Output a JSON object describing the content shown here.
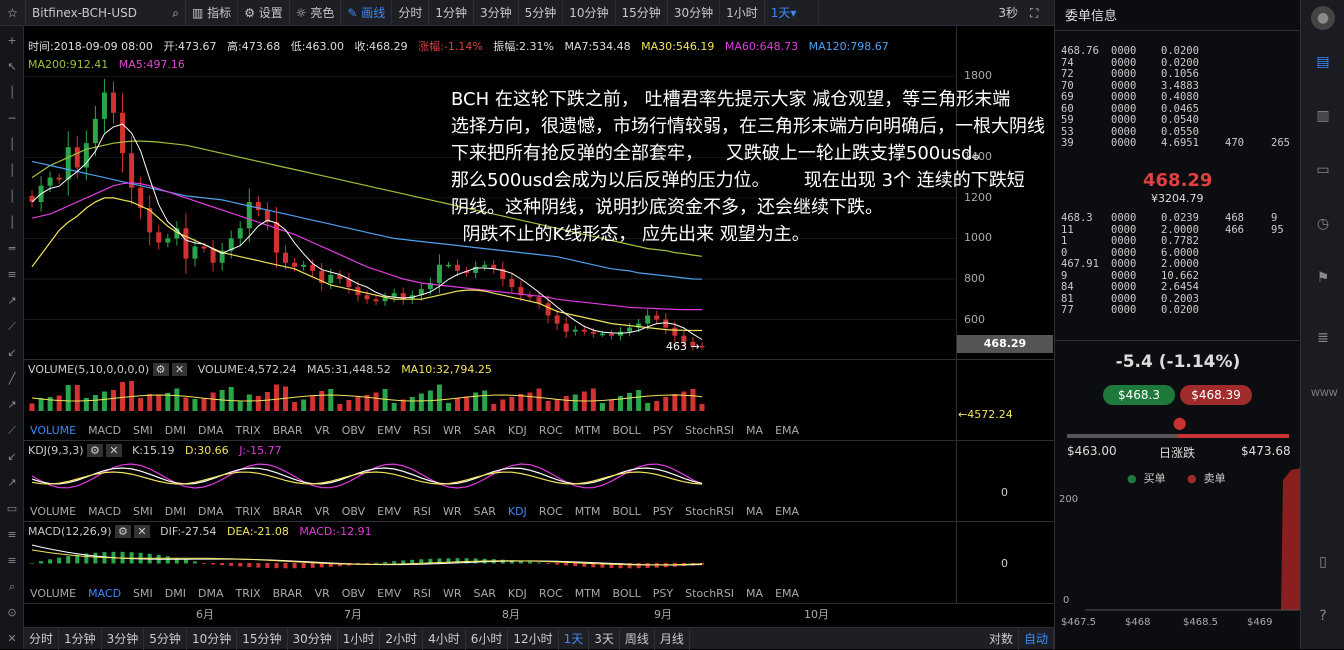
{
  "toolbar": {
    "symbol": "Bitfinex-BCH-USD",
    "indicators": "指标",
    "settings": "设置",
    "theme": "亮色",
    "draw": "画线",
    "intervals": [
      "分时",
      "1分钟",
      "3分钟",
      "5分钟",
      "10分钟",
      "15分钟",
      "30分钟",
      "1小时"
    ],
    "interval_selected": "1天▾",
    "refresh": "3秒",
    "fullscreen_icon": "expand-icon"
  },
  "info": {
    "time": "时间:2018-09-09 08:00",
    "open": "开:473.67",
    "high": "高:473.68",
    "low": "低:463.00",
    "close": "收:468.29",
    "chg": "涨幅:-1.14%",
    "amp": "振幅:2.31%",
    "ma7": "MA7:534.48",
    "ma30": "MA30:546.19",
    "ma60": "MA60:648.73",
    "ma120": "MA120:798.67",
    "ma200": "MA200:912.41",
    "ma5": "MA5:497.16"
  },
  "colors": {
    "ma30": "#f2e35a",
    "ma60": "#e03ae0",
    "ma120": "#4ea1f0",
    "ma200": "#9ec23a",
    "ma5": "#ffffff",
    "up": "#2aa64a",
    "down": "#d23232",
    "accent": "#3d8af7"
  },
  "annotation": [
    "BCH 在这轮下跌之前， 吐槽君率先提示大家 减仓观望，等三角形末端",
    "选择方向，很遗憾，市场行情较弱，在三角形末端方向明确后，一根大阴线",
    "下来把所有抢反弹的全部套牢，    又跌破上一轮止跌支撑500usd。",
    "那么500usd会成为以后反弹的压力位。      现在出现 3个 连续的下跌短",
    "阴线。这种阴线，说明抄底资金不多，还会继续下跌。",
    "  阴跌不止的K线形态， 应先出来 观望为主。"
  ],
  "price_axis": [
    "1800",
    "1400",
    "1200",
    "1000",
    "800",
    "600"
  ],
  "last_price_tag": "468.29",
  "low_marker": "463 →",
  "volume": {
    "title": "VOLUME(5,10,0,0,0,0)",
    "vol": "VOLUME:4,572.24",
    "ma5": "MA5:31,448.52",
    "ma10": "MA10:32,794.25",
    "last": "←4572.24"
  },
  "kdj": {
    "title": "KDJ(9,3,3)",
    "k": "K:15.19",
    "d": "D:30.66",
    "j": "J:-15.77",
    "zero": "0"
  },
  "macd": {
    "title": "MACD(12,26,9)",
    "dif": "DIF:-27.54",
    "dea": "DEA:-21.08",
    "macd": "MACD:-12.91",
    "zero": "0"
  },
  "indicator_tabs": [
    "VOLUME",
    "MACD",
    "SMI",
    "DMI",
    "DMA",
    "TRIX",
    "BRAR",
    "VR",
    "OBV",
    "EMV",
    "RSI",
    "WR",
    "SAR",
    "KDJ",
    "ROC",
    "MTM",
    "BOLL",
    "PSY",
    "StochRSI",
    "MA",
    "EMA"
  ],
  "months": [
    "6月",
    "7月",
    "8月",
    "9月",
    "10月"
  ],
  "bottom_intervals": [
    "分时",
    "1分钟",
    "3分钟",
    "5分钟",
    "10分钟",
    "15分钟",
    "30分钟",
    "1小时",
    "2小时",
    "4小时",
    "6小时",
    "12小时",
    "1天",
    "3天",
    "周线",
    "月线"
  ],
  "bottom_right": [
    "对数",
    "自动"
  ],
  "orderbook": {
    "title": "委单信息",
    "asks": [
      [
        "468.76",
        "0000",
        "0.0200"
      ],
      [
        "74",
        "0000",
        "0.0200"
      ],
      [
        "72",
        "0000",
        "0.1056"
      ],
      [
        "70",
        "0000",
        "3.4883"
      ],
      [
        "69",
        "0000",
        "0.4080"
      ],
      [
        "60",
        "0000",
        "0.0465"
      ],
      [
        "59",
        "0000",
        "0.0540"
      ],
      [
        "53",
        "0000",
        "0.0550"
      ],
      [
        "39",
        "0000",
        "4.6951",
        "470",
        "265"
      ]
    ],
    "price": "468.29",
    "price_cny": "¥3204.79",
    "bids": [
      [
        "468.3",
        "0000",
        "0.0239",
        "468",
        "9"
      ],
      [
        "11",
        "0000",
        "2.0000",
        "466",
        "95"
      ],
      [
        "1",
        "0000",
        "0.7782"
      ],
      [
        "0",
        "0000",
        "6.0000"
      ],
      [
        "467.91",
        "0000",
        "2.0000"
      ],
      [
        "9",
        "0000",
        "10.662"
      ],
      [
        "84",
        "0000",
        "2.6454"
      ],
      [
        "81",
        "0000",
        "0.2003"
      ],
      [
        "77",
        "0000",
        "0.0200"
      ]
    ]
  },
  "stats": {
    "change": "-5.4 (-1.14%)",
    "bid": "$468.3",
    "ask": "$468.39",
    "low": "$463.00",
    "mid_label": "日涨跌",
    "high": "$473.68",
    "buy": "买单",
    "sell": "卖单",
    "depth_axis": [
      "200",
      "0"
    ],
    "depth_x": [
      "$467.5",
      "$468",
      "$468.5",
      "$469"
    ]
  },
  "chart_data": {
    "type": "candlestick",
    "title": "Bitfinex-BCH-USD",
    "interval": "1天",
    "ylim": [
      420,
      1900
    ],
    "yticks": [
      600,
      800,
      1000,
      1200,
      1400,
      1800
    ],
    "x_months": [
      "6月",
      "7月",
      "8月",
      "9月",
      "10月"
    ],
    "close_series": [
      1180,
      1260,
      1300,
      1290,
      1450,
      1350,
      1470,
      1590,
      1720,
      1620,
      1420,
      1250,
      1150,
      1030,
      980,
      1000,
      1050,
      900,
      960,
      950,
      880,
      940,
      1000,
      1050,
      1180,
      1140,
      1080,
      930,
      880,
      860,
      870,
      840,
      780,
      820,
      800,
      760,
      720,
      700,
      690,
      710,
      730,
      700,
      720,
      750,
      780,
      870,
      870,
      840,
      830,
      860,
      870,
      850,
      800,
      760,
      720,
      710,
      680,
      620,
      580,
      540,
      550,
      540,
      530,
      530,
      520,
      540,
      560,
      580,
      620,
      600,
      560,
      520,
      490,
      470,
      468
    ],
    "ma30": [
      860,
      920,
      980,
      1040,
      1080,
      1110,
      1150,
      1180,
      1200,
      1200,
      1190,
      1180,
      1160,
      1140,
      1100,
      1060,
      1030,
      1010,
      990,
      970,
      950,
      930,
      920,
      910,
      900,
      890,
      880,
      870,
      860,
      850,
      830,
      810,
      790,
      770,
      760,
      750,
      740,
      730,
      720,
      710,
      700,
      700,
      700,
      700,
      710,
      720,
      730,
      740,
      745,
      745,
      740,
      730,
      720,
      710,
      700,
      690,
      680,
      660,
      640,
      630,
      620,
      610,
      600,
      590,
      580,
      575,
      570,
      565,
      560,
      555,
      550,
      548,
      547,
      546,
      546
    ],
    "ma60": [
      1100,
      1110,
      1120,
      1140,
      1160,
      1180,
      1200,
      1220,
      1240,
      1260,
      1270,
      1275,
      1270,
      1260,
      1245,
      1230,
      1215,
      1200,
      1185,
      1170,
      1155,
      1140,
      1125,
      1110,
      1095,
      1080,
      1065,
      1050,
      1035,
      1020,
      1000,
      980,
      960,
      940,
      920,
      900,
      880,
      860,
      845,
      830,
      815,
      800,
      790,
      780,
      775,
      770,
      765,
      760,
      755,
      750,
      745,
      740,
      735,
      730,
      725,
      720,
      715,
      710,
      700,
      695,
      690,
      685,
      680,
      675,
      670,
      665,
      660,
      658,
      656,
      654,
      652,
      650,
      649,
      649,
      649
    ],
    "ma120": [
      1380,
      1370,
      1360,
      1350,
      1340,
      1330,
      1320,
      1310,
      1300,
      1290,
      1280,
      1270,
      1260,
      1250,
      1240,
      1230,
      1220,
      1210,
      1205,
      1200,
      1195,
      1190,
      1180,
      1170,
      1160,
      1150,
      1140,
      1130,
      1120,
      1110,
      1100,
      1090,
      1080,
      1070,
      1060,
      1050,
      1040,
      1030,
      1020,
      1010,
      1000,
      995,
      990,
      985,
      980,
      975,
      970,
      965,
      960,
      955,
      950,
      945,
      940,
      935,
      930,
      925,
      920,
      915,
      910,
      900,
      890,
      880,
      870,
      860,
      850,
      845,
      840,
      830,
      825,
      820,
      815,
      810,
      805,
      800,
      799
    ],
    "ma200": [
      1300,
      1330,
      1360,
      1380,
      1400,
      1420,
      1440,
      1450,
      1460,
      1470,
      1475,
      1480,
      1480,
      1478,
      1475,
      1470,
      1465,
      1460,
      1450,
      1440,
      1430,
      1420,
      1410,
      1400,
      1390,
      1380,
      1370,
      1360,
      1350,
      1340,
      1330,
      1320,
      1310,
      1300,
      1290,
      1280,
      1270,
      1260,
      1250,
      1240,
      1230,
      1220,
      1210,
      1200,
      1190,
      1180,
      1170,
      1160,
      1150,
      1140,
      1130,
      1120,
      1110,
      1100,
      1090,
      1080,
      1070,
      1060,
      1050,
      1040,
      1030,
      1020,
      1010,
      1000,
      990,
      980,
      970,
      960,
      950,
      945,
      940,
      930,
      925,
      918,
      912
    ]
  }
}
